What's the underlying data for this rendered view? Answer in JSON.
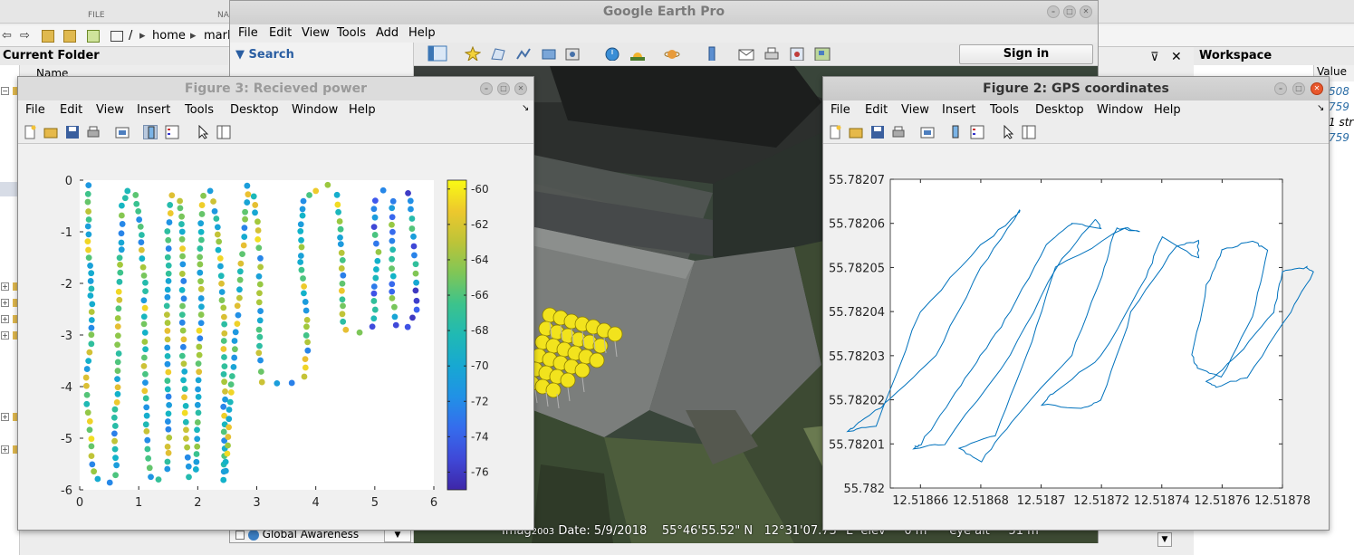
{
  "matlab": {
    "ribbon_sections": [
      "FILE",
      "NA"
    ],
    "path_crumbs": [
      "/",
      "home",
      "mark"
    ],
    "current_folder_title": "Current Folder",
    "name_header": "Name",
    "workspace_title": "Workspace",
    "workspace_value_header": "Value",
    "workspace_values": [
      "508",
      "759",
      "1 str",
      "759"
    ]
  },
  "google_earth": {
    "title": "Google Earth Pro",
    "menu": [
      "File",
      "Edit",
      "View",
      "Tools",
      "Add",
      "Help"
    ],
    "search_label": "Search",
    "sign_in": "Sign in",
    "layer_item": "Global Awareness",
    "status": {
      "imagery": "Imag",
      "year": "2003",
      "date": "Date: 5/9/2018",
      "lat": "55°46'55.52\" N",
      "lon": "12°31'07.73\" E",
      "elev": "elev",
      "elev_val": "0 m",
      "eye": "eye alt",
      "eye_val": "51 m"
    }
  },
  "figure3": {
    "title": "Figure 3: Recieved power",
    "menu": [
      "File",
      "Edit",
      "View",
      "Insert",
      "Tools",
      "Desktop",
      "Window",
      "Help"
    ],
    "chart_data": {
      "type": "scatter",
      "title": "",
      "xlim": [
        0,
        6
      ],
      "ylim": [
        -6,
        0
      ],
      "x_ticks": [
        "0",
        "1",
        "2",
        "3",
        "4",
        "5",
        "6"
      ],
      "y_ticks": [
        "0",
        "-1",
        "-2",
        "-3",
        "-4",
        "-5",
        "-6"
      ],
      "colorbar": {
        "min": -77,
        "max": -59.5,
        "ticks": [
          "-60",
          "-62",
          "-64",
          "-66",
          "-68",
          "-70",
          "-72",
          "-74",
          "-76"
        ],
        "colormap": "parula"
      },
      "path_points": [
        [
          0.15,
          -0.1
        ],
        [
          0.15,
          -0.6
        ],
        [
          0.15,
          -1.2
        ],
        [
          0.18,
          -1.8
        ],
        [
          0.2,
          -2.4
        ],
        [
          0.2,
          -3.0
        ],
        [
          0.15,
          -3.5
        ],
        [
          0.1,
          -4.0
        ],
        [
          0.15,
          -4.5
        ],
        [
          0.2,
          -5.0
        ],
        [
          0.2,
          -5.5
        ],
        [
          0.3,
          -5.8
        ],
        [
          0.5,
          -5.85
        ],
        [
          0.62,
          -5.7
        ],
        [
          0.6,
          -5.2
        ],
        [
          0.6,
          -4.6
        ],
        [
          0.65,
          -4.0
        ],
        [
          0.65,
          -3.2
        ],
        [
          0.65,
          -2.5
        ],
        [
          0.68,
          -1.8
        ],
        [
          0.7,
          -1.2
        ],
        [
          0.72,
          -0.5
        ],
        [
          0.8,
          -0.2
        ],
        [
          0.95,
          -0.3
        ],
        [
          1.0,
          -0.6
        ],
        [
          1.05,
          -1.2
        ],
        [
          1.1,
          -2.0
        ],
        [
          1.1,
          -2.8
        ],
        [
          1.1,
          -3.6
        ],
        [
          1.12,
          -4.4
        ],
        [
          1.15,
          -5.2
        ],
        [
          1.2,
          -5.75
        ],
        [
          1.35,
          -5.8
        ],
        [
          1.5,
          -5.6
        ],
        [
          1.5,
          -5.0
        ],
        [
          1.5,
          -4.2
        ],
        [
          1.5,
          -3.4
        ],
        [
          1.48,
          -2.6
        ],
        [
          1.5,
          -1.8
        ],
        [
          1.5,
          -1.0
        ],
        [
          1.55,
          -0.3
        ],
        [
          1.7,
          -0.4
        ],
        [
          1.75,
          -1.0
        ],
        [
          1.75,
          -1.8
        ],
        [
          1.75,
          -2.6
        ],
        [
          1.75,
          -3.4
        ],
        [
          1.78,
          -4.2
        ],
        [
          1.8,
          -5.0
        ],
        [
          1.85,
          -5.75
        ],
        [
          1.98,
          -5.6
        ],
        [
          2.0,
          -5.0
        ],
        [
          2.0,
          -4.2
        ],
        [
          2.02,
          -3.4
        ],
        [
          2.05,
          -2.6
        ],
        [
          2.05,
          -1.8
        ],
        [
          2.05,
          -1.0
        ],
        [
          2.1,
          -0.3
        ],
        [
          2.2,
          -0.2
        ],
        [
          2.3,
          -0.6
        ],
        [
          2.35,
          -1.2
        ],
        [
          2.4,
          -2.0
        ],
        [
          2.45,
          -2.8
        ],
        [
          2.45,
          -3.6
        ],
        [
          2.45,
          -4.4
        ],
        [
          2.45,
          -5.2
        ],
        [
          2.45,
          -5.8
        ],
        [
          2.85,
          -0.1
        ],
        [
          2.95,
          -0.3
        ],
        [
          3.0,
          -0.8
        ],
        [
          3.05,
          -1.5
        ],
        [
          3.05,
          -2.2
        ],
        [
          3.05,
          -2.9
        ],
        [
          3.05,
          -3.5
        ],
        [
          3.1,
          -3.9
        ],
        [
          3.35,
          -3.95
        ],
        [
          3.6,
          -3.92
        ],
        [
          3.8,
          -3.8
        ],
        [
          3.85,
          -3.3
        ],
        [
          3.85,
          -2.7
        ],
        [
          3.8,
          -2.2
        ],
        [
          3.75,
          -1.6
        ],
        [
          3.75,
          -1.0
        ],
        [
          3.8,
          -0.4
        ],
        [
          4.0,
          -0.2
        ],
        [
          4.2,
          -0.1
        ],
        [
          4.35,
          -0.3
        ],
        [
          4.4,
          -0.8
        ],
        [
          4.45,
          -1.4
        ],
        [
          4.45,
          -2.0
        ],
        [
          4.45,
          -2.6
        ],
        [
          4.5,
          -2.9
        ],
        [
          4.75,
          -2.95
        ],
        [
          4.95,
          -2.85
        ],
        [
          5.0,
          -2.5
        ],
        [
          5.0,
          -1.9
        ],
        [
          5.05,
          -1.4
        ],
        [
          5.0,
          -0.9
        ],
        [
          5.0,
          -0.4
        ],
        [
          5.15,
          -0.2
        ],
        [
          5.3,
          -0.4
        ],
        [
          5.3,
          -1.0
        ],
        [
          5.3,
          -1.7
        ],
        [
          5.3,
          -2.3
        ],
        [
          5.35,
          -2.8
        ],
        [
          5.55,
          -2.85
        ],
        [
          5.7,
          -2.5
        ],
        [
          5.7,
          -1.8
        ],
        [
          5.65,
          -1.1
        ],
        [
          5.6,
          -0.4
        ],
        [
          5.55,
          -0.1
        ]
      ]
    }
  },
  "figure2": {
    "title": "Figure 2: GPS coordinates",
    "menu": [
      "File",
      "Edit",
      "View",
      "Insert",
      "Tools",
      "Desktop",
      "Window",
      "Help"
    ],
    "chart_data": {
      "type": "line",
      "title": "",
      "xlim": [
        12.51865,
        12.51878
      ],
      "ylim": [
        55.782,
        55.78207
      ],
      "x_ticks": [
        "12.51866",
        "12.51868",
        "12.5187",
        "12.51872",
        "12.51874",
        "12.51876",
        "12.51878"
      ],
      "y_ticks": [
        "55.78207",
        "55.78206",
        "55.78205",
        "55.78204",
        "55.78203",
        "55.78202",
        "55.78201",
        "55.782"
      ],
      "series": [
        {
          "x": [
            12.518693,
            12.51868,
            12.518665,
            12.51865,
            12.51864,
            12.518636,
            12.518645,
            12.51866,
            12.51868,
            12.518692,
            12.518693
          ],
          "y": [
            55.782063,
            55.78205,
            55.78203,
            55.78202,
            55.782015,
            55.782013,
            55.782014,
            55.78204,
            55.782055,
            55.782062,
            55.782063
          ]
        },
        {
          "x": [
            12.51871,
            12.518702,
            12.51869,
            12.51868,
            12.51867,
            12.51866,
            12.518658,
            12.518668,
            12.51869,
            12.518705,
            12.518718,
            12.51872,
            12.51871
          ],
          "y": [
            55.78206,
            55.782055,
            55.78204,
            55.78203,
            55.78202,
            55.78201,
            55.782009,
            55.78201,
            55.78203,
            55.78205,
            55.782061,
            55.782059,
            55.78206
          ]
        },
        {
          "x": [
            12.518725,
            12.51872,
            12.51871,
            12.51869,
            12.51868,
            12.518673,
            12.518685,
            12.518695,
            12.518705,
            12.518728,
            12.518733,
            12.518725
          ],
          "y": [
            55.782059,
            55.782048,
            55.78203,
            55.782015,
            55.782006,
            55.782009,
            55.782012,
            55.78203,
            55.78205,
            55.782059,
            55.782058,
            55.782059
          ]
        },
        {
          "x": [
            12.51874,
            12.518735,
            12.51872,
            12.518705,
            12.5187,
            12.518713,
            12.51872,
            12.51873,
            12.518745,
            12.518752,
            12.518752,
            12.51874
          ],
          "y": [
            55.782057,
            55.782048,
            55.78203,
            55.782022,
            55.782019,
            55.782018,
            55.78202,
            55.78204,
            55.782055,
            55.782056,
            55.782052,
            55.782057
          ]
        },
        {
          "x": [
            12.51876,
            12.518755,
            12.51875,
            12.518752,
            12.51876,
            12.51877,
            12.518775,
            12.51877,
            12.51876
          ],
          "y": [
            55.782054,
            55.782046,
            55.78203,
            55.782027,
            55.782025,
            55.782039,
            55.782054,
            55.782056,
            55.782054
          ]
        },
        {
          "x": [
            12.51878,
            12.518777,
            12.518765,
            12.518755,
            12.518758,
            12.518768,
            12.518783,
            12.51879,
            12.518788,
            12.51878
          ],
          "y": [
            55.782049,
            55.78204,
            55.78203,
            55.782024,
            55.782023,
            55.782025,
            55.78204,
            55.782049,
            55.78205,
            55.782049
          ]
        }
      ]
    }
  }
}
